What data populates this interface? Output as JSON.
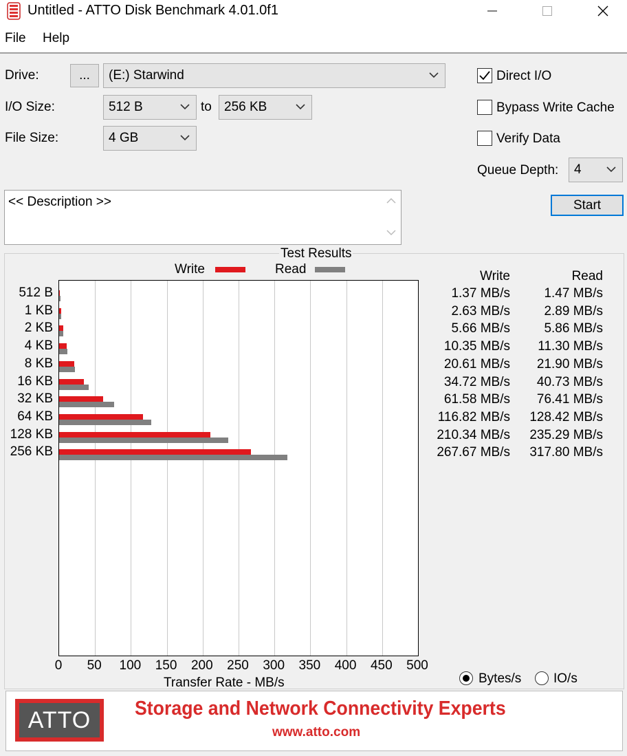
{
  "window": {
    "title": "Untitled - ATTO Disk Benchmark 4.01.0f1"
  },
  "menu": {
    "file": "File",
    "help": "Help"
  },
  "form": {
    "drive_label": "Drive:",
    "browse_label": "...",
    "drive_value": "(E:) Starwind",
    "io_size_label": "I/O Size:",
    "io_from": "512 B",
    "to_label": "to",
    "io_to": "256 KB",
    "file_size_label": "File Size:",
    "file_size": "4 GB",
    "direct_io_label": "Direct I/O",
    "direct_io_checked": true,
    "bypass_cache_label": "Bypass Write Cache",
    "bypass_cache_checked": false,
    "verify_label": "Verify Data",
    "verify_checked": false,
    "queue_label": "Queue Depth:",
    "queue_value": "4",
    "start_label": "Start",
    "description": "<< Description >>"
  },
  "results": {
    "title": "Test Results",
    "write_header": "Write",
    "read_header": "Read",
    "rows": [
      {
        "size": "512 B",
        "write": "1.37 MB/s",
        "read": "1.47 MB/s"
      },
      {
        "size": "1 KB",
        "write": "2.63 MB/s",
        "read": "2.89 MB/s"
      },
      {
        "size": "2 KB",
        "write": "5.66 MB/s",
        "read": "5.86 MB/s"
      },
      {
        "size": "4 KB",
        "write": "10.35 MB/s",
        "read": "11.30 MB/s"
      },
      {
        "size": "8 KB",
        "write": "20.61 MB/s",
        "read": "21.90 MB/s"
      },
      {
        "size": "16 KB",
        "write": "34.72 MB/s",
        "read": "40.73 MB/s"
      },
      {
        "size": "32 KB",
        "write": "61.58 MB/s",
        "read": "76.41 MB/s"
      },
      {
        "size": "64 KB",
        "write": "116.82 MB/s",
        "read": "128.42 MB/s"
      },
      {
        "size": "128 KB",
        "write": "210.34 MB/s",
        "read": "235.29 MB/s"
      },
      {
        "size": "256 KB",
        "write": "267.67 MB/s",
        "read": "317.80 MB/s"
      }
    ],
    "unit_bytes_label": "Bytes/s",
    "unit_io_label": "IO/s",
    "unit_selected": "Bytes/s"
  },
  "chart_data": {
    "type": "bar",
    "orientation": "horizontal",
    "categories": [
      "512 B",
      "1 KB",
      "2 KB",
      "4 KB",
      "8 KB",
      "16 KB",
      "32 KB",
      "64 KB",
      "128 KB",
      "256 KB"
    ],
    "series": [
      {
        "name": "Write",
        "color": "#e0191e",
        "values": [
          1.37,
          2.63,
          5.66,
          10.35,
          20.61,
          34.72,
          61.58,
          116.82,
          210.34,
          267.67
        ]
      },
      {
        "name": "Read",
        "color": "#808080",
        "values": [
          1.47,
          2.89,
          5.86,
          11.3,
          21.9,
          40.73,
          76.41,
          128.42,
          235.29,
          317.8
        ]
      }
    ],
    "xlabel": "Transfer Rate - MB/s",
    "xlim": [
      0,
      500
    ],
    "xticks": [
      "0",
      "50",
      "100",
      "150",
      "200",
      "250",
      "300",
      "350",
      "400",
      "450",
      "500"
    ],
    "grid": true,
    "legend_position": "top"
  },
  "banner": {
    "logo_text": "ATTO",
    "tagline": "Storage and Network Connectivity Experts",
    "url": "www.atto.com"
  },
  "colors": {
    "accent_blue": "#0078d7",
    "write_red": "#e0191e",
    "read_gray": "#808080",
    "brand_red": "#d82b2b"
  }
}
